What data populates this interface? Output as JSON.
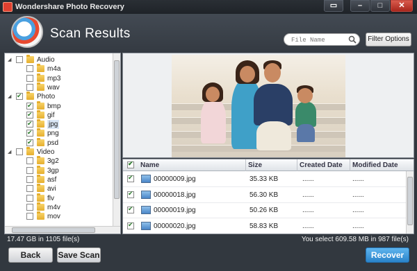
{
  "window": {
    "title": "Wondershare Photo Recovery"
  },
  "header": {
    "title": "Scan Results"
  },
  "search": {
    "placeholder": "File Name"
  },
  "toolbar": {
    "filter_label": "Filter Options"
  },
  "tree": {
    "items": [
      {
        "label": "Audio",
        "level": 0,
        "checked": false,
        "expanded": true
      },
      {
        "label": "m4a",
        "level": 1,
        "checked": false
      },
      {
        "label": "mp3",
        "level": 1,
        "checked": false
      },
      {
        "label": "wav",
        "level": 1,
        "checked": false
      },
      {
        "label": "Photo",
        "level": 0,
        "checked": true,
        "expanded": true
      },
      {
        "label": "bmp",
        "level": 1,
        "checked": true
      },
      {
        "label": "gif",
        "level": 1,
        "checked": true
      },
      {
        "label": "jpg",
        "level": 1,
        "checked": true,
        "selected": true
      },
      {
        "label": "png",
        "level": 1,
        "checked": true
      },
      {
        "label": "psd",
        "level": 1,
        "checked": true
      },
      {
        "label": "Video",
        "level": 0,
        "checked": false,
        "expanded": true
      },
      {
        "label": "3g2",
        "level": 1,
        "checked": false
      },
      {
        "label": "3gp",
        "level": 1,
        "checked": false
      },
      {
        "label": "asf",
        "level": 1,
        "checked": false
      },
      {
        "label": "avi",
        "level": 1,
        "checked": false
      },
      {
        "label": "flv",
        "level": 1,
        "checked": false
      },
      {
        "label": "m4v",
        "level": 1,
        "checked": false
      },
      {
        "label": "mov",
        "level": 1,
        "checked": false
      }
    ]
  },
  "grid": {
    "columns": [
      "Name",
      "Size",
      "Created Date",
      "Modified Date"
    ],
    "rows": [
      {
        "name": "00000009.jpg",
        "size": "35.33 KB",
        "created": "......",
        "modified": "......"
      },
      {
        "name": "00000018.jpg",
        "size": "56.30 KB",
        "created": "......",
        "modified": "......"
      },
      {
        "name": "00000019.jpg",
        "size": "50.26 KB",
        "created": "......",
        "modified": "......"
      },
      {
        "name": "00000020.jpg",
        "size": "58.83 KB",
        "created": "......",
        "modified": "......"
      }
    ]
  },
  "status": {
    "left": "17.47 GB in 1105 file(s)",
    "right": "You select 609.58 MB in 987 file(s)"
  },
  "buttons": {
    "back": "Back",
    "save_scan": "Save Scan",
    "recover": "Recover"
  },
  "colors": {
    "accent": "#2a83c9",
    "background": "#32383f",
    "close": "#c0463c"
  }
}
